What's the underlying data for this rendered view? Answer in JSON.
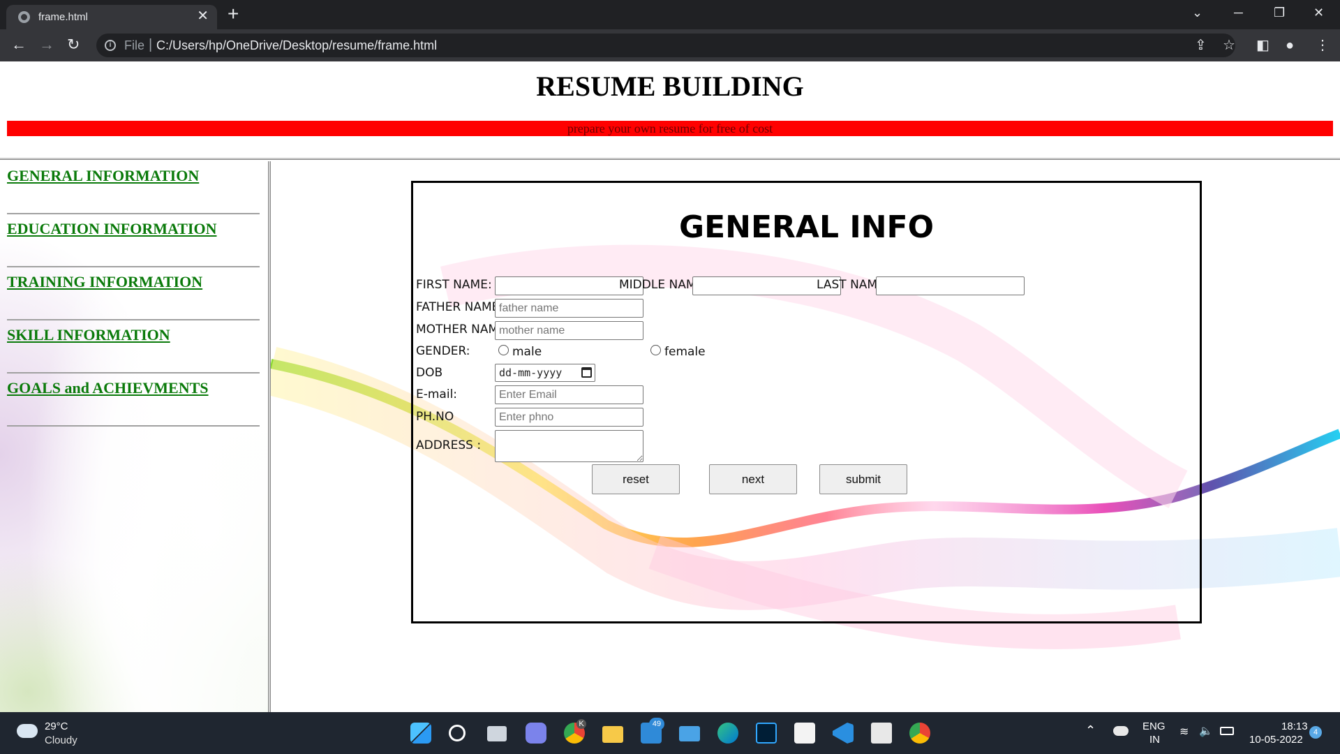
{
  "browser": {
    "tab_title": "frame.html",
    "scheme_label": "File",
    "separator": "|",
    "url": "C:/Users/hp/OneDrive/Desktop/resume/frame.html"
  },
  "header": {
    "title": "RESUME BUILDING",
    "tagline": "prepare your own resume for free of cost"
  },
  "sidebar": {
    "items": [
      {
        "label": "GENERAL INFORMATION"
      },
      {
        "label": "EDUCATION INFORMATION"
      },
      {
        "label": "TRAINING INFORMATION"
      },
      {
        "label": "SKILL INFORMATION"
      },
      {
        "label": "GOALS and ACHIEVMENTS"
      }
    ]
  },
  "form": {
    "title": "GENERAL INFO",
    "first_name_label": "FIRST NAME:",
    "first_name_value": "",
    "middle_name_label": "MIDDLE NAME",
    "middle_name_value": "",
    "last_name_label": "LAST NAME:",
    "last_name_value": "",
    "father_name_label": "FATHER NAME:",
    "father_name_placeholder": "father name",
    "mother_name_label": "MOTHER NAME:",
    "mother_name_placeholder": "mother name",
    "gender_label": "GENDER:",
    "gender_options": [
      "male",
      "female"
    ],
    "dob_label": "DOB",
    "dob_value": "dd-mm-yyyy",
    "email_label": "E-mail:",
    "email_placeholder": "Enter Email",
    "phone_label": "PH.NO",
    "phone_placeholder": "Enter phno",
    "address_label": "ADDRESS :",
    "buttons": {
      "reset": "reset",
      "next": "next",
      "submit": "submit"
    }
  },
  "taskbar": {
    "temperature": "29°C",
    "condition": "Cloudy",
    "language": "ENG",
    "region": "IN",
    "time": "18:13",
    "date": "10-05-2022",
    "mail_badge": "49",
    "notification_count": "4",
    "chrome_profile_letter": "K"
  },
  "colors": {
    "accent_red": "#ff0000",
    "nav_link": "#0a7a0a"
  }
}
